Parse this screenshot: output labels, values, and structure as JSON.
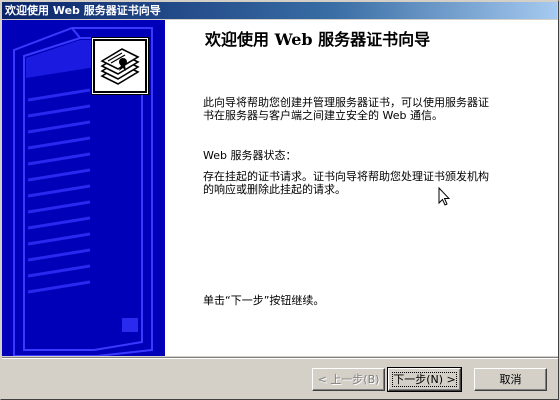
{
  "window": {
    "title": "欢迎使用 Web 服务器证书向导"
  },
  "content": {
    "heading": "欢迎使用 Web 服务器证书向导",
    "intro": "此向导将帮助您创建并管理服务器证书，可以使用服务器证书在服务器与客户端之间建立安全的 Web 通信。",
    "status_label": "Web 服务器状态：",
    "status_text": "存在挂起的证书请求。证书向导将帮助您处理证书颁发机构的响应或删除此挂起的请求。",
    "continue_hint": "单击“下一步”按钮继续。"
  },
  "buttons": {
    "back": "< 上一步(B)",
    "next": "下一步(N) >",
    "cancel": "取消"
  },
  "colors": {
    "side_panel": "#0000b8",
    "title_start": "#0a246a",
    "title_end": "#a6caf0"
  },
  "icons": {
    "side_logo": "certificate-document-icon",
    "cursor": "mouse-pointer-icon"
  }
}
